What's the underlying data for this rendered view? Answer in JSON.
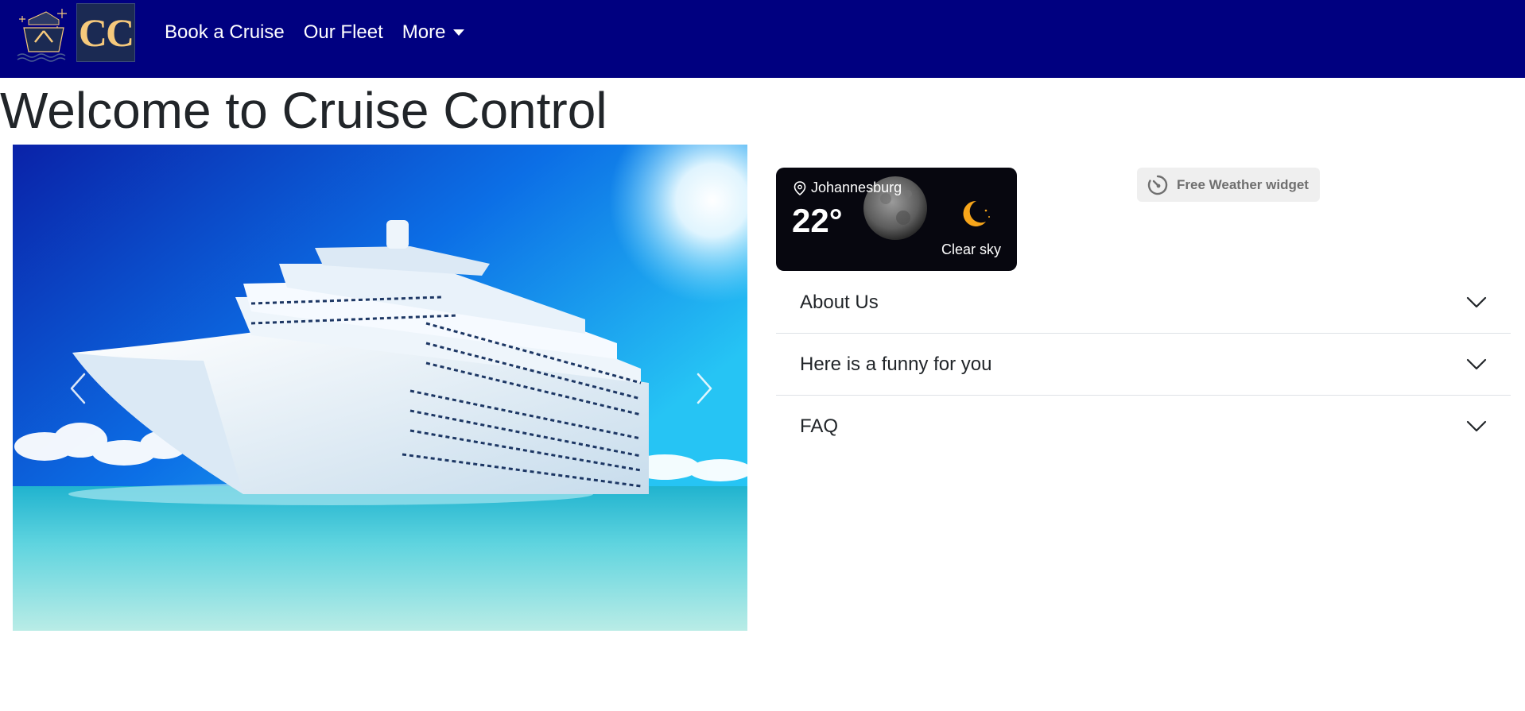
{
  "brand": {
    "logo_text": "CC"
  },
  "nav": {
    "links": [
      "Book a Cruise",
      "Our Fleet"
    ],
    "more_label": "More"
  },
  "page": {
    "title": "Welcome to Cruise Control"
  },
  "carousel": {
    "prev_icon": "chevron-left-icon",
    "next_icon": "chevron-right-icon"
  },
  "weather": {
    "location": "Johannesburg",
    "temperature": "22°",
    "condition": "Clear sky",
    "condition_icon": "crescent-moon-icon"
  },
  "weather_widget_link": {
    "label": "Free Weather widget"
  },
  "accordion": {
    "items": [
      "About Us",
      "Here is a funny for you",
      "FAQ"
    ]
  },
  "colors": {
    "navbar": "#000080",
    "logo_text": "#f6c97c",
    "weather_bg": "#07070f",
    "moon_icon": "#f7a51a"
  }
}
